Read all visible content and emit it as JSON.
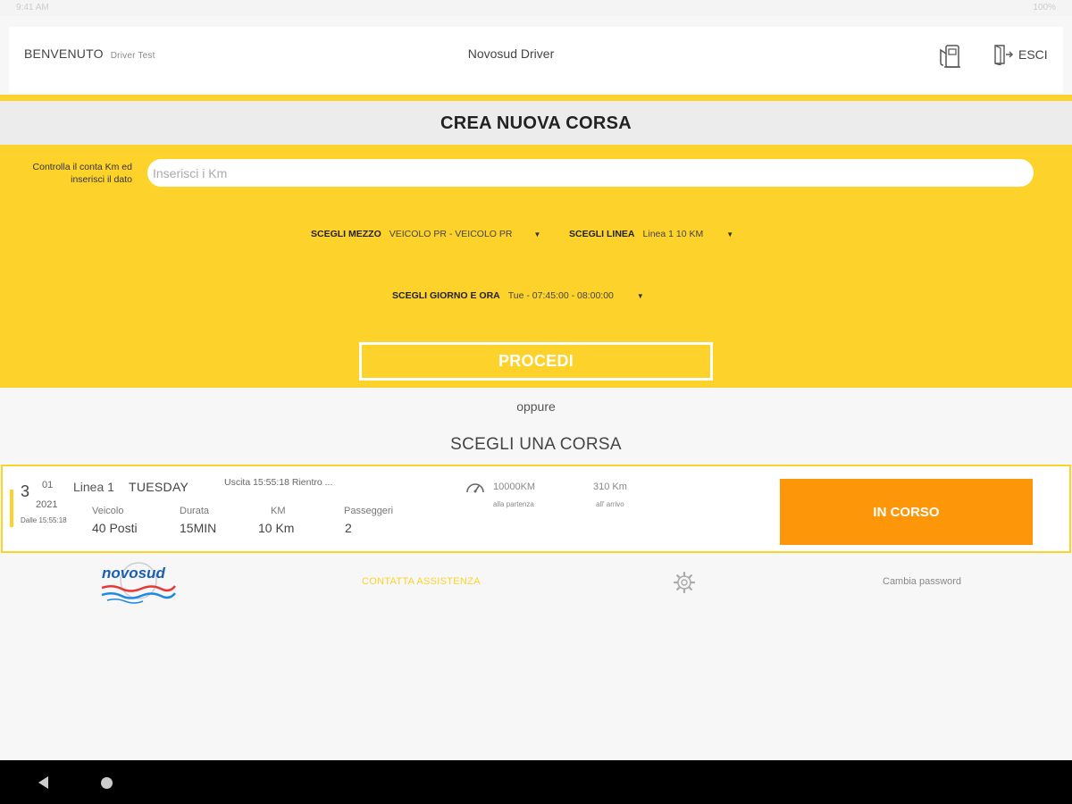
{
  "status_bar": {
    "left": "9:41 AM",
    "right": "100%"
  },
  "header": {
    "welcome": "BENVENUTO",
    "user": "Driver Test",
    "app_title": "Novosud Driver",
    "fuel_icon": "fuel-pump-icon",
    "exit_icon": "exit-door-icon",
    "exit_label": "ESCI"
  },
  "create": {
    "title": "CREA NUOVA CORSA",
    "km_label": "Controlla il conta Km ed inserisci il dato",
    "km_placeholder": "Inserisci i Km",
    "km_value": "",
    "vehicle_label": "SCEGLI MEZZO",
    "vehicle_value": "VEICOLO PR - VEICOLO PR",
    "line_label": "SCEGLI LINEA",
    "line_value": "Linea 1 10 KM",
    "day_label": "SCEGLI GIORNO E ORA",
    "day_value": "Tue - 07:45:00 - 08:00:00",
    "proceed_label": "PROCEDI"
  },
  "oppure": "oppure",
  "choose_title": "SCEGLI UNA CORSA",
  "ride": {
    "day": "3",
    "month": "01",
    "year": "2021",
    "from": "Dalle 15:55:18",
    "line": "Linea 1",
    "weekday": "TUESDAY",
    "times": "Uscita 15:55:18 Rientro ...",
    "vehicle_label": "Veicolo",
    "vehicle_value": "40 Posti",
    "duration_label": "Durata",
    "duration_value": "15MIN",
    "km_label": "KM",
    "km_value": "10 Km",
    "passengers_label": "Passeggeri",
    "passengers_value": "2",
    "km_start": "10000KM",
    "km_start_sub": "alla partenza",
    "km_end": "310 Km",
    "km_end_sub": "all' arrivo",
    "status_label": "IN CORSO"
  },
  "footer": {
    "logo_text": "novosud",
    "assistance": "CONTATTA ASSISTENZA",
    "settings_icon": "gear-icon",
    "change_password": "Cambia password"
  },
  "colors": {
    "accent": "#fdd22a",
    "status": "#fd9608",
    "background": "#f7f7f7"
  }
}
